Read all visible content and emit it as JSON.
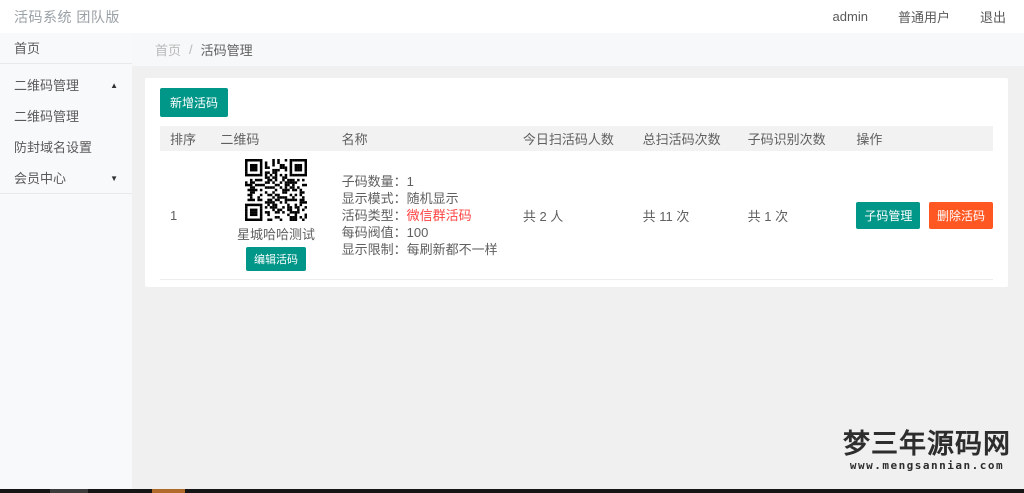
{
  "header": {
    "title": "活码系统 团队版",
    "username": "admin",
    "role": "普通用户",
    "logout": "退出"
  },
  "sidebar": {
    "items": [
      {
        "label": "首页"
      },
      {
        "label": "二维码管理"
      },
      {
        "label": "二维码管理"
      },
      {
        "label": "防封域名设置"
      },
      {
        "label": "会员中心"
      }
    ]
  },
  "breadcrumb": {
    "home": "首页",
    "separator": "/",
    "current": "活码管理"
  },
  "toolbar": {
    "add_button": "新增活码"
  },
  "table": {
    "headers": [
      "排序",
      "二维码",
      "名称",
      "今日扫活码人数",
      "总扫活码次数",
      "子码识别次数",
      "操作"
    ],
    "row": {
      "order": "1",
      "qr_name": "星城哈哈测试",
      "edit_button": "编辑活码",
      "details": [
        {
          "label": "子码数量：",
          "value": "1"
        },
        {
          "label": "显示模式：",
          "value": "随机显示"
        },
        {
          "label": "活码类型：",
          "value": "微信群活码"
        },
        {
          "label": "每码阀值：",
          "value": "100"
        },
        {
          "label": "显示限制：",
          "value": "每刷新都不一样"
        }
      ],
      "today_scan_people": "共 2 人",
      "total_scan_times": "共 11 次",
      "subcode_scan_times": "共 1 次",
      "manage_button": "子码管理",
      "delete_button": "删除活码"
    }
  },
  "watermark": {
    "title": "梦三年源码网",
    "url": "www.mengsannian.com"
  },
  "colors": {
    "accent_teal": "#009688",
    "accent_danger": "#FF5722",
    "red_text": "#ff4242",
    "header_bg": "#f2f2f2"
  }
}
